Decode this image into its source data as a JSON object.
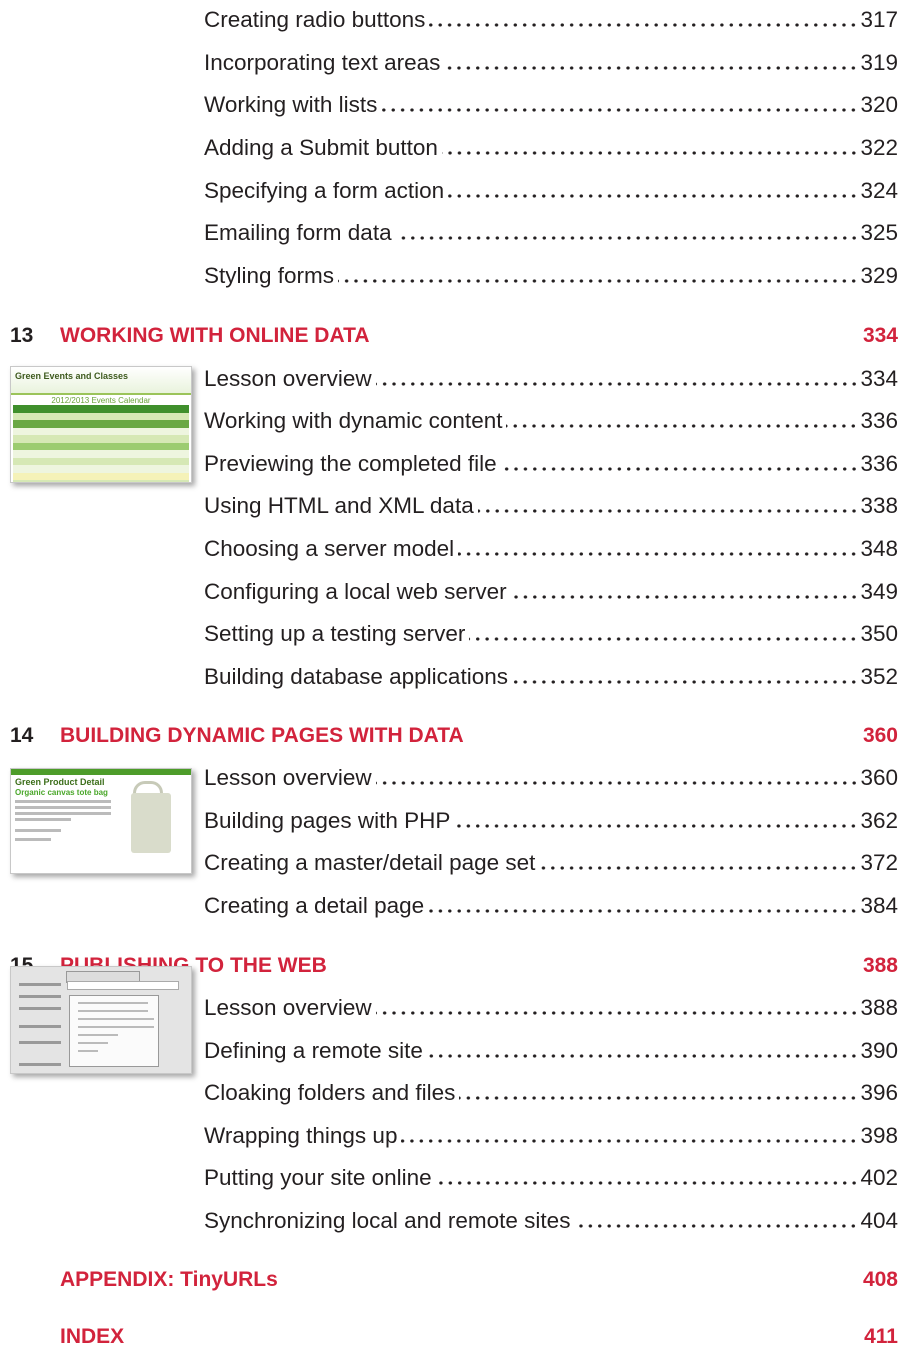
{
  "sections": {
    "prev": {
      "entries": [
        {
          "label": "Creating radio buttons",
          "page": "317"
        },
        {
          "label": "Incorporating text areas",
          "page": "319"
        },
        {
          "label": "Working with lists",
          "page": "320"
        },
        {
          "label": "Adding a Submit button",
          "page": "322"
        },
        {
          "label": "Specifying a form action",
          "page": "324"
        },
        {
          "label": "Emailing form data",
          "page": "325"
        },
        {
          "label": "Styling forms",
          "page": "329"
        }
      ]
    },
    "ch13": {
      "number": "13",
      "title": "WORKING WITH ONLINE DATA",
      "page": "334",
      "thumbnail": {
        "title": "Green Events and Classes",
        "subtitle": "2012/2013 Events Calendar"
      },
      "entries": [
        {
          "label": "Lesson overview",
          "page": "334"
        },
        {
          "label": "Working with dynamic content",
          "page": "336"
        },
        {
          "label": "Previewing the completed file",
          "page": "336"
        },
        {
          "label": "Using HTML and XML data",
          "page": "338"
        },
        {
          "label": "Choosing a server model",
          "page": "348"
        },
        {
          "label": "Configuring a local web server",
          "page": "349"
        },
        {
          "label": "Setting up a testing server",
          "page": "350"
        },
        {
          "label": "Building database applications",
          "page": "352"
        }
      ]
    },
    "ch14": {
      "number": "14",
      "title": "BUILDING DYNAMIC PAGES WITH DATA",
      "page": "360",
      "thumbnail": {
        "title": "Green Product Detail",
        "subtitle": "Organic canvas tote bag"
      },
      "entries": [
        {
          "label": "Lesson overview",
          "page": "360"
        },
        {
          "label": "Building pages with PHP",
          "page": "362"
        },
        {
          "label": "Creating a master/detail page set",
          "page": "372"
        },
        {
          "label": "Creating a detail page",
          "page": "384"
        }
      ]
    },
    "ch15": {
      "number": "15",
      "title": "PUBLISHING TO THE WEB",
      "page": "388",
      "entries": [
        {
          "label": "Lesson overview",
          "page": "388"
        },
        {
          "label": "Defining a remote site",
          "page": "390"
        },
        {
          "label": "Cloaking folders and files",
          "page": "396"
        },
        {
          "label": "Wrapping things up",
          "page": "398"
        },
        {
          "label": "Putting your site online",
          "page": "402"
        },
        {
          "label": "Synchronizing local and remote sites",
          "page": "404"
        }
      ]
    },
    "appendix": {
      "title": "APPENDIX: TinyURLs",
      "page": "408"
    },
    "index": {
      "title": "INDEX",
      "page": "411"
    }
  },
  "colors": {
    "accent": "#d2233c",
    "text": "#231f20"
  }
}
